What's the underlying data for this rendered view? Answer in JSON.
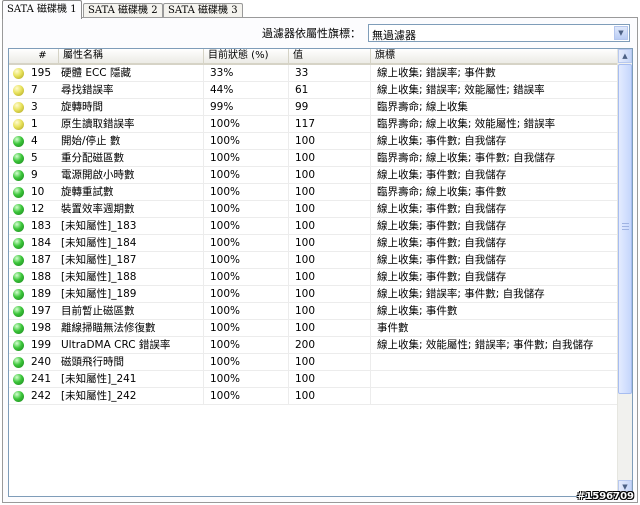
{
  "tabs": [
    {
      "label": "SATA 磁碟機 1",
      "active": true
    },
    {
      "label": "SATA 磁碟機 2",
      "active": false
    },
    {
      "label": "SATA 磁碟機 3",
      "active": false
    }
  ],
  "filter": {
    "label": "過濾器依屬性旗標：",
    "selected": "無過濾器"
  },
  "table": {
    "columns": [
      "#",
      "屬性名稱",
      "目前狀態 (%)",
      "值",
      "旗標"
    ],
    "rows": [
      {
        "status": "yellow",
        "id": "195",
        "name": "硬體 ECC 隱藏",
        "current": "33%",
        "value": "33",
        "flags": "線上收集; 錯誤率; 事件數"
      },
      {
        "status": "yellow",
        "id": "7",
        "name": "尋找錯誤率",
        "current": "44%",
        "value": "61",
        "flags": "線上收集; 錯誤率; 效能屬性; 錯誤率"
      },
      {
        "status": "yellow",
        "id": "3",
        "name": "旋轉時間",
        "current": "99%",
        "value": "99",
        "flags": "臨界壽命; 線上收集"
      },
      {
        "status": "yellow",
        "id": "1",
        "name": "原生讀取錯誤率",
        "current": "100%",
        "value": "117",
        "flags": "臨界壽命; 線上收集; 效能屬性; 錯誤率"
      },
      {
        "status": "green",
        "id": "4",
        "name": "開始/停止 數",
        "current": "100%",
        "value": "100",
        "flags": "線上收集; 事件數; 自我儲存"
      },
      {
        "status": "green",
        "id": "5",
        "name": "重分配磁區數",
        "current": "100%",
        "value": "100",
        "flags": "臨界壽命; 線上收集; 事件數; 自我儲存"
      },
      {
        "status": "green",
        "id": "9",
        "name": "電源開啟小時數",
        "current": "100%",
        "value": "100",
        "flags": "線上收集; 事件數; 自我儲存"
      },
      {
        "status": "green",
        "id": "10",
        "name": "旋轉重試數",
        "current": "100%",
        "value": "100",
        "flags": "臨界壽命; 線上收集; 事件數"
      },
      {
        "status": "green",
        "id": "12",
        "name": "裝置效率週期數",
        "current": "100%",
        "value": "100",
        "flags": "線上收集; 事件數; 自我儲存"
      },
      {
        "status": "green",
        "id": "183",
        "name": "[未知屬性]_183",
        "current": "100%",
        "value": "100",
        "flags": "線上收集; 事件數; 自我儲存"
      },
      {
        "status": "green",
        "id": "184",
        "name": "[未知屬性]_184",
        "current": "100%",
        "value": "100",
        "flags": "線上收集; 事件數; 自我儲存"
      },
      {
        "status": "green",
        "id": "187",
        "name": "[未知屬性]_187",
        "current": "100%",
        "value": "100",
        "flags": "線上收集; 事件數; 自我儲存"
      },
      {
        "status": "green",
        "id": "188",
        "name": "[未知屬性]_188",
        "current": "100%",
        "value": "100",
        "flags": "線上收集; 事件數; 自我儲存"
      },
      {
        "status": "green",
        "id": "189",
        "name": "[未知屬性]_189",
        "current": "100%",
        "value": "100",
        "flags": "線上收集; 錯誤率; 事件數; 自我儲存"
      },
      {
        "status": "green",
        "id": "197",
        "name": "目前暫止磁區數",
        "current": "100%",
        "value": "100",
        "flags": "線上收集; 事件數"
      },
      {
        "status": "green",
        "id": "198",
        "name": "離線掃瞄無法修復數",
        "current": "100%",
        "value": "100",
        "flags": "事件數"
      },
      {
        "status": "green",
        "id": "199",
        "name": "UltraDMA CRC 錯誤率",
        "current": "100%",
        "value": "200",
        "flags": "線上收集; 效能屬性; 錯誤率; 事件數; 自我儲存"
      },
      {
        "status": "green",
        "id": "240",
        "name": "磁頭飛行時間",
        "current": "100%",
        "value": "100",
        "flags": ""
      },
      {
        "status": "green",
        "id": "241",
        "name": "[未知屬性]_241",
        "current": "100%",
        "value": "100",
        "flags": ""
      },
      {
        "status": "green",
        "id": "242",
        "name": "[未知屬性]_242",
        "current": "100%",
        "value": "100",
        "flags": ""
      }
    ]
  },
  "watermark": "#1596709"
}
